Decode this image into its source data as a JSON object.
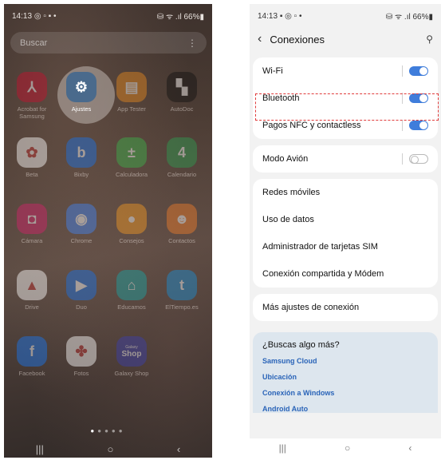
{
  "left": {
    "status": {
      "time": "14:13",
      "left_icons": "◎ ▫ ▪ •",
      "right_icons": "⛁ ᯤ .ıl 66%▮"
    },
    "search_placeholder": "Buscar",
    "apps": [
      {
        "label": "Acrobat for Samsung",
        "icon": "acrobat-icon",
        "color": "#c8102e",
        "glyph": "⅄"
      },
      {
        "label": "Ajustes",
        "icon": "gear-icon",
        "color": "#4a6a8c",
        "glyph": "⚙"
      },
      {
        "label": "App Tester",
        "icon": "app-tester-icon",
        "color": "#e8891e",
        "glyph": "▤"
      },
      {
        "label": "AutoDoc",
        "icon": "autodoc-icon",
        "color": "#111111",
        "glyph": "▚"
      },
      {
        "label": "Beta",
        "icon": "beta-icon",
        "color": "#ffffff",
        "glyph": "✿"
      },
      {
        "label": "Bixby",
        "icon": "bixby-icon",
        "color": "#1a73e8",
        "glyph": "b"
      },
      {
        "label": "Calculadora",
        "icon": "calculator-icon",
        "color": "#3cb44b",
        "glyph": "±"
      },
      {
        "label": "Calendario",
        "icon": "calendar-icon",
        "color": "#2e9e52",
        "glyph": "4"
      },
      {
        "label": "Cámara",
        "icon": "camera-icon",
        "color": "#d6236b",
        "glyph": "◘"
      },
      {
        "label": "Chrome",
        "icon": "chrome-icon",
        "color": "#4285f4",
        "glyph": "◉"
      },
      {
        "label": "Consejos",
        "icon": "tips-icon",
        "color": "#f59a23",
        "glyph": "●"
      },
      {
        "label": "Contactos",
        "icon": "contacts-icon",
        "color": "#f07d2a",
        "glyph": "☻"
      },
      {
        "label": "Drive",
        "icon": "drive-icon",
        "color": "#ffffff",
        "glyph": "▲"
      },
      {
        "label": "Duo",
        "icon": "duo-icon",
        "color": "#1a73e8",
        "glyph": "▶"
      },
      {
        "label": "Educamos",
        "icon": "educamos-icon",
        "color": "#1aa5a5",
        "glyph": "⌂"
      },
      {
        "label": "ElTiempo.es",
        "icon": "eltiempo-icon",
        "color": "#1a8fd6",
        "glyph": "t"
      },
      {
        "label": "Facebook",
        "icon": "facebook-icon",
        "color": "#1877f2",
        "glyph": "f"
      },
      {
        "label": "Fotos",
        "icon": "photos-icon",
        "color": "#ffffff",
        "glyph": "✤"
      },
      {
        "label": "Galaxy Shop",
        "icon": "galaxy-shop-icon",
        "color": "#3b3fae",
        "glyph": "Shop"
      }
    ],
    "galaxy_small": "Galaxy",
    "page_dots": "● ● ● ● ●",
    "nav": {
      "recents": "|||",
      "home": "○",
      "back": "‹"
    }
  },
  "right": {
    "status": {
      "time": "14:13",
      "left_icons": "▪ ◎ ▫ •",
      "right_icons": "⛁ ᯤ .ıl 66%▮"
    },
    "header": {
      "back": "‹",
      "title": "Conexiones",
      "search": "⚲"
    },
    "group1": [
      {
        "label": "Wi-Fi",
        "toggle": "on"
      },
      {
        "label": "Bluetooth",
        "toggle": "on"
      },
      {
        "label": "Pagos NFC y contactless",
        "toggle": "on"
      }
    ],
    "airplane": {
      "label": "Modo Avión",
      "toggle": "off"
    },
    "group2": [
      {
        "label": "Redes móviles"
      },
      {
        "label": "Uso de datos"
      },
      {
        "label": "Administrador de tarjetas SIM"
      },
      {
        "label": "Conexión compartida y Módem"
      }
    ],
    "more": {
      "label": "Más ajustes de conexión"
    },
    "suggest": {
      "question": "¿Buscas algo más?",
      "links": [
        "Samsung Cloud",
        "Ubicación",
        "Conexión a Windows",
        "Android Auto"
      ]
    },
    "nav": {
      "recents": "|||",
      "home": "○",
      "back": "‹"
    },
    "colors": {
      "toggle_on": "#3f7ddb",
      "highlight": "#e03b3b",
      "link": "#2a64b8"
    }
  }
}
